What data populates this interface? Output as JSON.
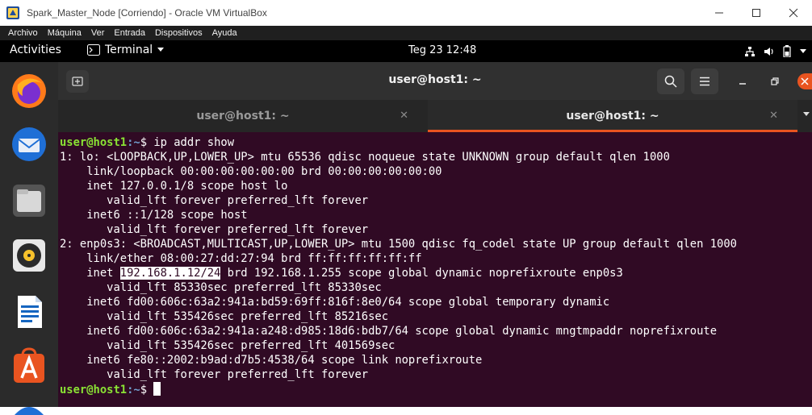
{
  "window": {
    "title": "Spark_Master_Node [Corriendo] - Oracle VM VirtualBox"
  },
  "vbox_menu": [
    "Archivo",
    "Máquina",
    "Ver",
    "Entrada",
    "Dispositivos",
    "Ayuda"
  ],
  "topbar": {
    "activities": "Activities",
    "app_menu": "Terminal",
    "clock": "Teg 23  12:48"
  },
  "terminal": {
    "header_title": "user@host1: ~",
    "tabs": [
      {
        "label": "user@host1: ~",
        "active": false
      },
      {
        "label": "user@host1: ~",
        "active": true
      }
    ],
    "prompt_user": "user@host1",
    "prompt_path": ":~",
    "prompt_symbol": "$ ",
    "command": "ip addr show",
    "lines": [
      "1: lo: <LOOPBACK,UP,LOWER_UP> mtu 65536 qdisc noqueue state UNKNOWN group default qlen 1000",
      "    link/loopback 00:00:00:00:00:00 brd 00:00:00:00:00:00",
      "    inet 127.0.0.1/8 scope host lo",
      "       valid_lft forever preferred_lft forever",
      "    inet6 ::1/128 scope host",
      "       valid_lft forever preferred_lft forever",
      "2: enp0s3: <BROADCAST,MULTICAST,UP,LOWER_UP> mtu 1500 qdisc fq_codel state UP group default qlen 1000",
      "    link/ether 08:00:27:dd:27:94 brd ff:ff:ff:ff:ff:ff"
    ],
    "inet_line": {
      "prefix": "    inet ",
      "highlighted": "192.168.1.12/24",
      "suffix": " brd 192.168.1.255 scope global dynamic noprefixroute enp0s3"
    },
    "lines_after": [
      "       valid_lft 85330sec preferred_lft 85330sec",
      "    inet6 fd00:606c:63a2:941a:bd59:69ff:816f:8e0/64 scope global temporary dynamic",
      "       valid_lft 535426sec preferred_lft 85216sec",
      "    inet6 fd00:606c:63a2:941a:a248:d985:18d6:bdb7/64 scope global dynamic mngtmpaddr noprefixroute",
      "       valid_lft 535426sec preferred_lft 401569sec",
      "    inet6 fe80::2002:b9ad:d7b5:4538/64 scope link noprefixroute",
      "       valid_lft forever preferred_lft forever"
    ]
  },
  "colors": {
    "terminal_bg": "#300a24",
    "prompt_user": "#8ae234",
    "prompt_path": "#729fcf",
    "accent": "#e95420"
  },
  "dock": [
    "firefox-icon",
    "thunderbird-icon",
    "files-icon",
    "rhythmbox-icon",
    "writer-icon",
    "software-icon"
  ]
}
